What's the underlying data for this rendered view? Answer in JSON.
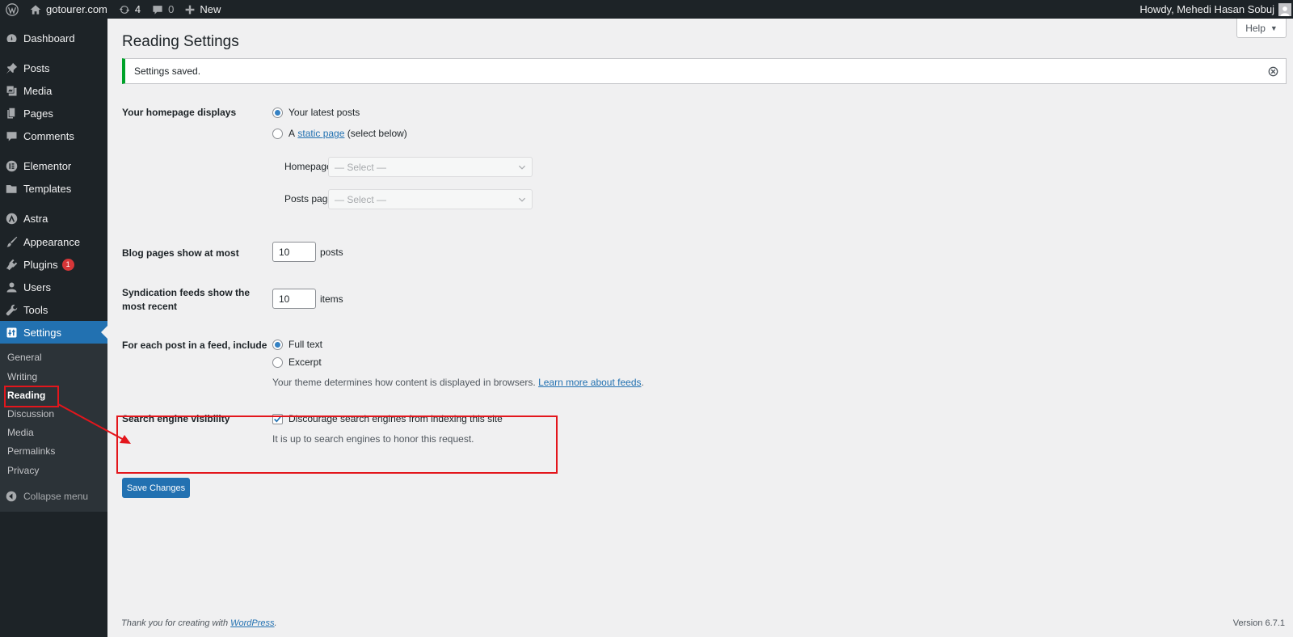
{
  "adminbar": {
    "site_name": "gotourer.com",
    "updates_count": "4",
    "comments_count": "0",
    "new_label": "New",
    "howdy": "Howdy, Mehedi Hasan Sobuj"
  },
  "sidebar": {
    "items": [
      {
        "label": "Dashboard",
        "icon": "dashboard-icon"
      },
      {
        "label": "Posts",
        "icon": "pin-icon"
      },
      {
        "label": "Media",
        "icon": "media-icon"
      },
      {
        "label": "Pages",
        "icon": "pages-icon"
      },
      {
        "label": "Comments",
        "icon": "comment-icon"
      },
      {
        "label": "Elementor",
        "icon": "elementor-icon"
      },
      {
        "label": "Templates",
        "icon": "folder-icon"
      },
      {
        "label": "Astra",
        "icon": "astra-icon"
      },
      {
        "label": "Appearance",
        "icon": "brush-icon"
      },
      {
        "label": "Plugins",
        "icon": "plug-icon",
        "badge": "1"
      },
      {
        "label": "Users",
        "icon": "user-icon"
      },
      {
        "label": "Tools",
        "icon": "wrench-icon"
      },
      {
        "label": "Settings",
        "icon": "settings-icon"
      }
    ],
    "submenu": [
      "General",
      "Writing",
      "Reading",
      "Discussion",
      "Media",
      "Permalinks",
      "Privacy"
    ],
    "collapse_label": "Collapse menu"
  },
  "help_label": "Help",
  "page_title": "Reading Settings",
  "notice": "Settings saved.",
  "homepage": {
    "label": "Your homepage displays",
    "option_latest": "Your latest posts",
    "option_static_prefix": "A",
    "option_static_link": "static page",
    "option_static_suffix": "(select below)",
    "homepage_label": "Homepage:",
    "posts_page_label": "Posts page:",
    "select_placeholder": "— Select —",
    "selected": "latest"
  },
  "blog_pages": {
    "label": "Blog pages show at most",
    "value": "10",
    "unit": "posts"
  },
  "syndication": {
    "label": "Syndication feeds show the most recent",
    "value": "10",
    "unit": "items"
  },
  "feed_include": {
    "label": "For each post in a feed, include",
    "option_full": "Full text",
    "option_excerpt": "Excerpt",
    "selected": "full",
    "description": "Your theme determines how content is displayed in browsers.",
    "learn_more": "Learn more about feeds",
    "period": "."
  },
  "search_visibility": {
    "label": "Search engine visibility",
    "checkbox_label": "Discourage search engines from indexing this site",
    "checked": true,
    "description": "It is up to search engines to honor this request."
  },
  "save_label": "Save Changes",
  "footer": {
    "thanks_prefix": "Thank you for creating with",
    "wordpress_link": "WordPress",
    "period": ".",
    "version": "Version 6.7.1"
  },
  "colors": {
    "accent": "#2271b1",
    "sidebar": "#1d2327",
    "notice_success": "#00a32a",
    "annotation": "#e3161c"
  }
}
